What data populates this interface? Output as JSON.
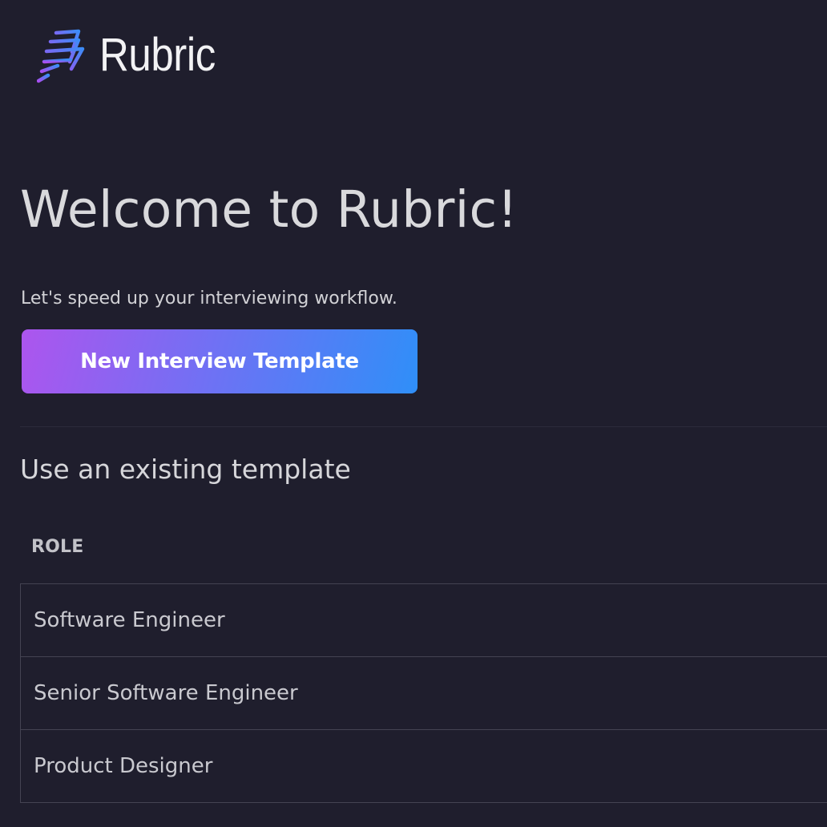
{
  "brand": {
    "name": "Rubric",
    "gradient_start": "#a84ff0",
    "gradient_end": "#3c8cf7"
  },
  "welcome": {
    "title": "Welcome to Rubric!",
    "subtitle": "Let's speed up your interviewing workflow."
  },
  "new_template_button": {
    "label": "New Interview Template",
    "gradient_start": "#ad55ee",
    "gradient_end": "#2f8ff8"
  },
  "existing_templates": {
    "section_title": "Use an existing template",
    "column_header": "ROLE",
    "rows": [
      {
        "role": "Software Engineer"
      },
      {
        "role": "Senior Software Engineer"
      },
      {
        "role": "Product Designer"
      }
    ]
  },
  "colors": {
    "background": "#1f1e2d",
    "text_primary": "#d9d9dc",
    "border": "#444352"
  }
}
